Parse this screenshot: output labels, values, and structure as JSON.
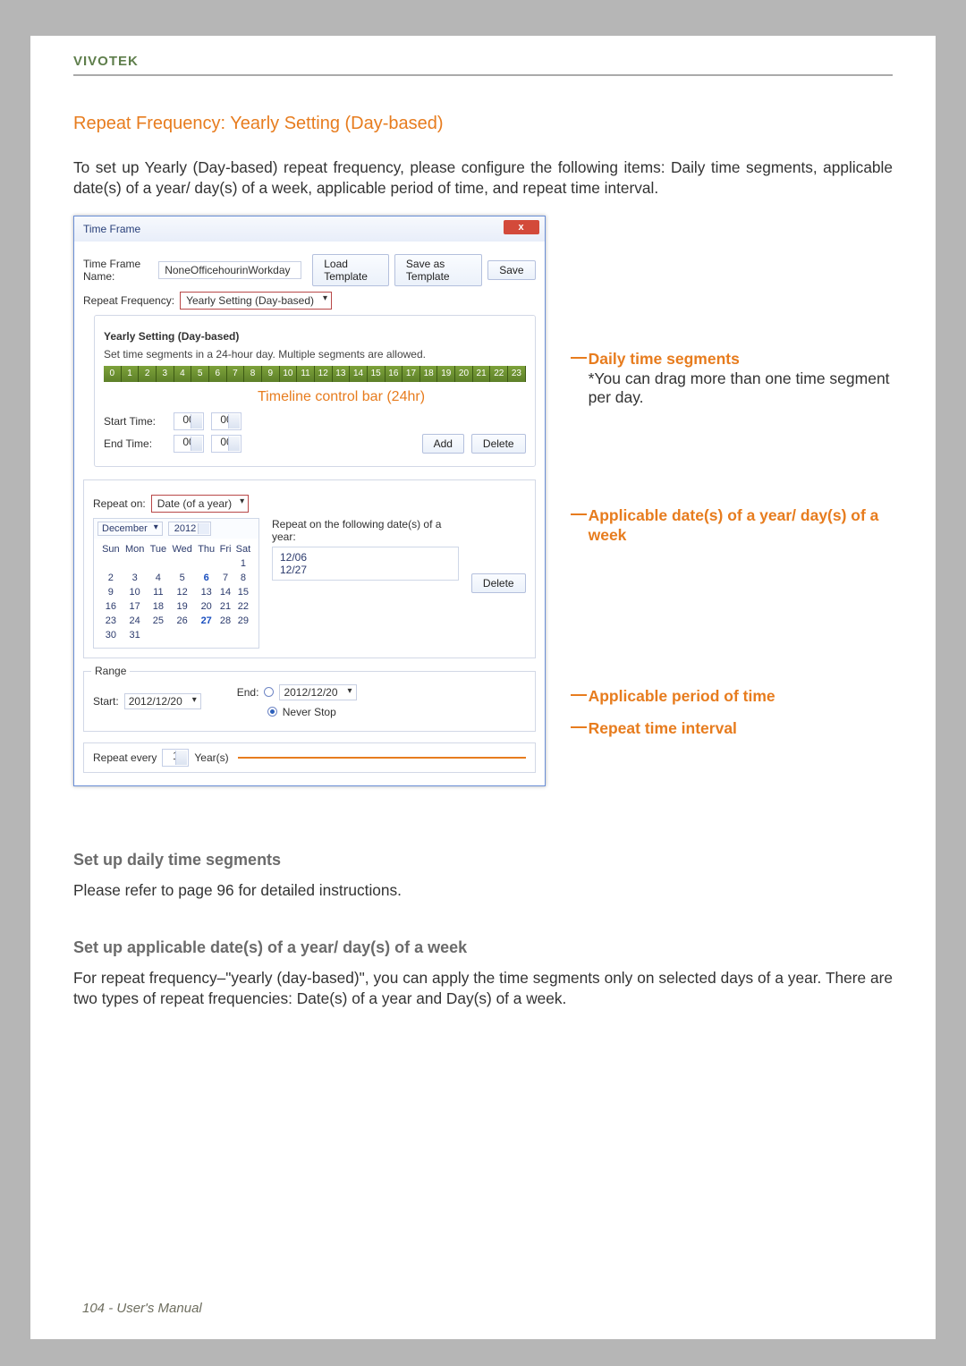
{
  "brand": "VIVOTEK",
  "title": "Repeat Frequency: Yearly Setting (Day-based)",
  "intro": "To set up Yearly (Day-based) repeat frequency, please configure the following items: Daily time segments, applicable date(s) of a year/ day(s) of a week, applicable period of time, and repeat time interval.",
  "dialog": {
    "window_title": "Time Frame",
    "name_label": "Time Frame Name:",
    "name_value": "NoneOfficehourinWorkday",
    "buttons": {
      "load": "Load Template",
      "save_as": "Save as Template",
      "save": "Save"
    },
    "freq_label": "Repeat Frequency:",
    "freq_value": "Yearly Setting (Day-based)",
    "yearly_title": "Yearly Setting (Day-based)",
    "seg_hint": "Set time segments in a 24-hour day. Multiple segments are allowed.",
    "timeline_hours": [
      "0",
      "1",
      "2",
      "3",
      "4",
      "5",
      "6",
      "7",
      "8",
      "9",
      "10",
      "11",
      "12",
      "13",
      "14",
      "15",
      "16",
      "17",
      "18",
      "19",
      "20",
      "21",
      "22",
      "23"
    ],
    "timeline_caption": "Timeline control bar (24hr)",
    "start_label": "Start Time:",
    "end_label": "End Time:",
    "start_h": "00",
    "start_m": "00",
    "end_h": "00",
    "end_m": "00",
    "add": "Add",
    "delete": "Delete",
    "repeat_on_label": "Repeat on:",
    "repeat_on_value": "Date (of a year)",
    "month": "December",
    "year": "2012",
    "repeat_dates_label": "Repeat on the following date(s) of a year:",
    "dates": [
      "12/06",
      "12/27"
    ],
    "weekdays": [
      "Sun",
      "Mon",
      "Tue",
      "Wed",
      "Thu",
      "Fri",
      "Sat"
    ],
    "cal_rows": [
      [
        "",
        "",
        "",
        "",
        "",
        "",
        "1"
      ],
      [
        "2",
        "3",
        "4",
        "5",
        "6",
        "7",
        "8"
      ],
      [
        "9",
        "10",
        "11",
        "12",
        "13",
        "14",
        "15"
      ],
      [
        "16",
        "17",
        "18",
        "19",
        "20",
        "21",
        "22"
      ],
      [
        "23",
        "24",
        "25",
        "26",
        "27",
        "28",
        "29"
      ],
      [
        "30",
        "31",
        "",
        "",
        "",
        "",
        ""
      ]
    ],
    "range_label": "Range",
    "range_start_label": "Start:",
    "range_start_value": "2012/12/20",
    "range_end_label": "End:",
    "range_end_value": "2012/12/20",
    "never_stop": "Never Stop",
    "repeat_every_label": "Repeat every",
    "repeat_every_value": "1",
    "repeat_every_unit": "Year(s)"
  },
  "annots": {
    "a1_t": "Daily time segments",
    "a1_b": "*You can drag more than one time segment per day.",
    "a2_t": "Applicable date(s) of a year/ day(s) of a week",
    "a3_t": "Applicable period of time",
    "a4_t": "Repeat time interval"
  },
  "lower": {
    "h1": "Set up daily time segments",
    "p1": "Please refer to page 96 for detailed instructions.",
    "h2": "Set up applicable date(s) of a year/ day(s) of a week",
    "p2": "For repeat frequency–\"yearly (day-based)\", you can apply the time segments only on selected days of a year. There are two types of repeat frequencies: Date(s) of a year and Day(s) of a week."
  },
  "footer": "104 - User's Manual"
}
